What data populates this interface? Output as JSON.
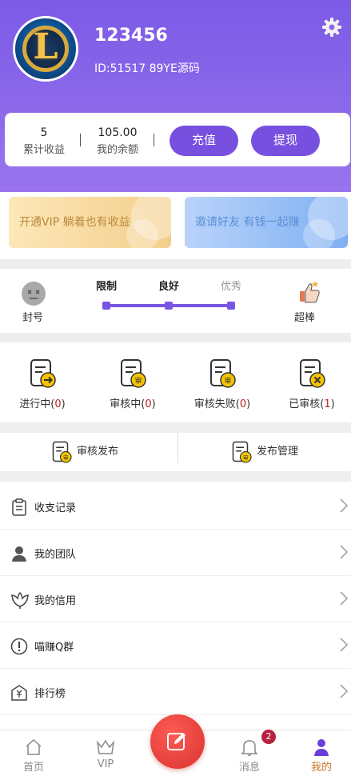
{
  "profile": {
    "username": "123456",
    "id_line": "ID:51517 89YE源码",
    "avatar_letter": "L"
  },
  "stats": {
    "income_value": "5",
    "income_label": "累计收益",
    "balance_value": "105.00",
    "balance_label": "我的余额",
    "recharge_label": "充值",
    "withdraw_label": "提现"
  },
  "banners": {
    "vip": "开通VIP 躺着也有收益",
    "invite": "邀请好友 有钱一起赚"
  },
  "credit": {
    "ban_label": "封号",
    "levels": [
      "限制",
      "良好",
      "优秀"
    ],
    "great_label": "超棒",
    "progress_percent": 100
  },
  "tasks": [
    {
      "label": "进行中",
      "count": "0"
    },
    {
      "label": "审核中",
      "count": "0"
    },
    {
      "label": "审核失败",
      "count": "0"
    },
    {
      "label": "已审核",
      "count": "1"
    }
  ],
  "publish": {
    "review_label": "审核发布",
    "manage_label": "发布管理",
    "badge_char": "审"
  },
  "menu": [
    {
      "label": "收支记录",
      "icon": "clipboard-icon"
    },
    {
      "label": "我的团队",
      "icon": "team-icon"
    },
    {
      "label": "我的信用",
      "icon": "flower-icon"
    },
    {
      "label": "喵赚Q群",
      "icon": "alert-circle-icon"
    },
    {
      "label": "排行榜",
      "icon": "yuan-envelope-icon"
    }
  ],
  "tabbar": {
    "home": "首页",
    "vip": "VIP",
    "messages": "消息",
    "mine": "我的",
    "message_badge": "2"
  },
  "colors": {
    "primary": "#7a55e3",
    "accent_tab": "#c8782a",
    "fab": "#d8332e"
  }
}
